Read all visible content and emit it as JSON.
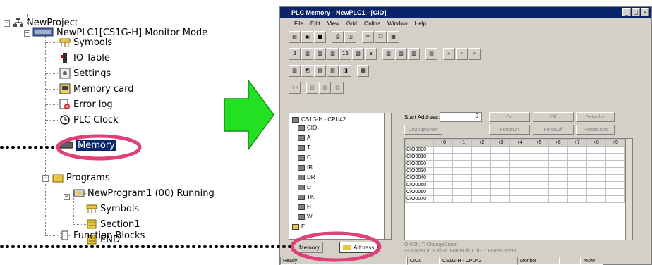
{
  "tree": {
    "project": "NewProject",
    "plc": "NewPLC1[CS1G-H] Monitor Mode",
    "items": [
      "Symbols",
      "IO Table",
      "Settings",
      "Memory card",
      "Error log",
      "PLC Clock",
      "Memory"
    ],
    "programs": "Programs",
    "program": "NewProgram1 (00) Running",
    "program_items": [
      "Symbols",
      "Section1",
      "END"
    ],
    "function_blocks": "Function Blocks"
  },
  "window": {
    "title": "PLC Memory - NewPLC1 - [CIO]",
    "title_buttons": [
      "_",
      "□",
      "×"
    ],
    "menu": [
      "File",
      "Edit",
      "View",
      "Grid",
      "Online",
      "Window",
      "Help"
    ]
  },
  "panel": {
    "root": "CS1G-H - CPU42",
    "areas": [
      "CIO",
      "A",
      "T",
      "C",
      "IR",
      "DR",
      "D",
      "TK",
      "H",
      "W",
      "E"
    ],
    "tabs": [
      "Memory",
      "Address"
    ]
  },
  "controls": {
    "start_address_label": "Start Address:",
    "start_address_value": "0",
    "buttons_row1": [
      "On",
      "Off",
      "SetValue"
    ],
    "buttons_row2": [
      "ChangeOrder",
      "ForceOn",
      "ForceOff",
      "ForceCanc"
    ]
  },
  "grid": {
    "columns": [
      "+0",
      "+1",
      "+2",
      "+3",
      "+4",
      "+5",
      "+6",
      "+7",
      "+8",
      "+9"
    ],
    "rows": [
      "CIO0000",
      "CIO0010",
      "CIO0020",
      "CIO0030",
      "CIO0040",
      "CIO0050",
      "CIO0060",
      "CIO0070"
    ]
  },
  "help": {
    "line1": "On/Off, T: ChangeOrder",
    "line2": "+I: ForceOn, Ctrl+K: ForceOff, Ctrl+L: ForceCancel"
  },
  "status": [
    "Ready",
    "CIO0",
    "CS1G-H - CPU42",
    "Monitor",
    "NUM"
  ],
  "colors": {
    "arrow": "#22e022",
    "highlight": "#e0407a",
    "selection": "#0a246a"
  }
}
